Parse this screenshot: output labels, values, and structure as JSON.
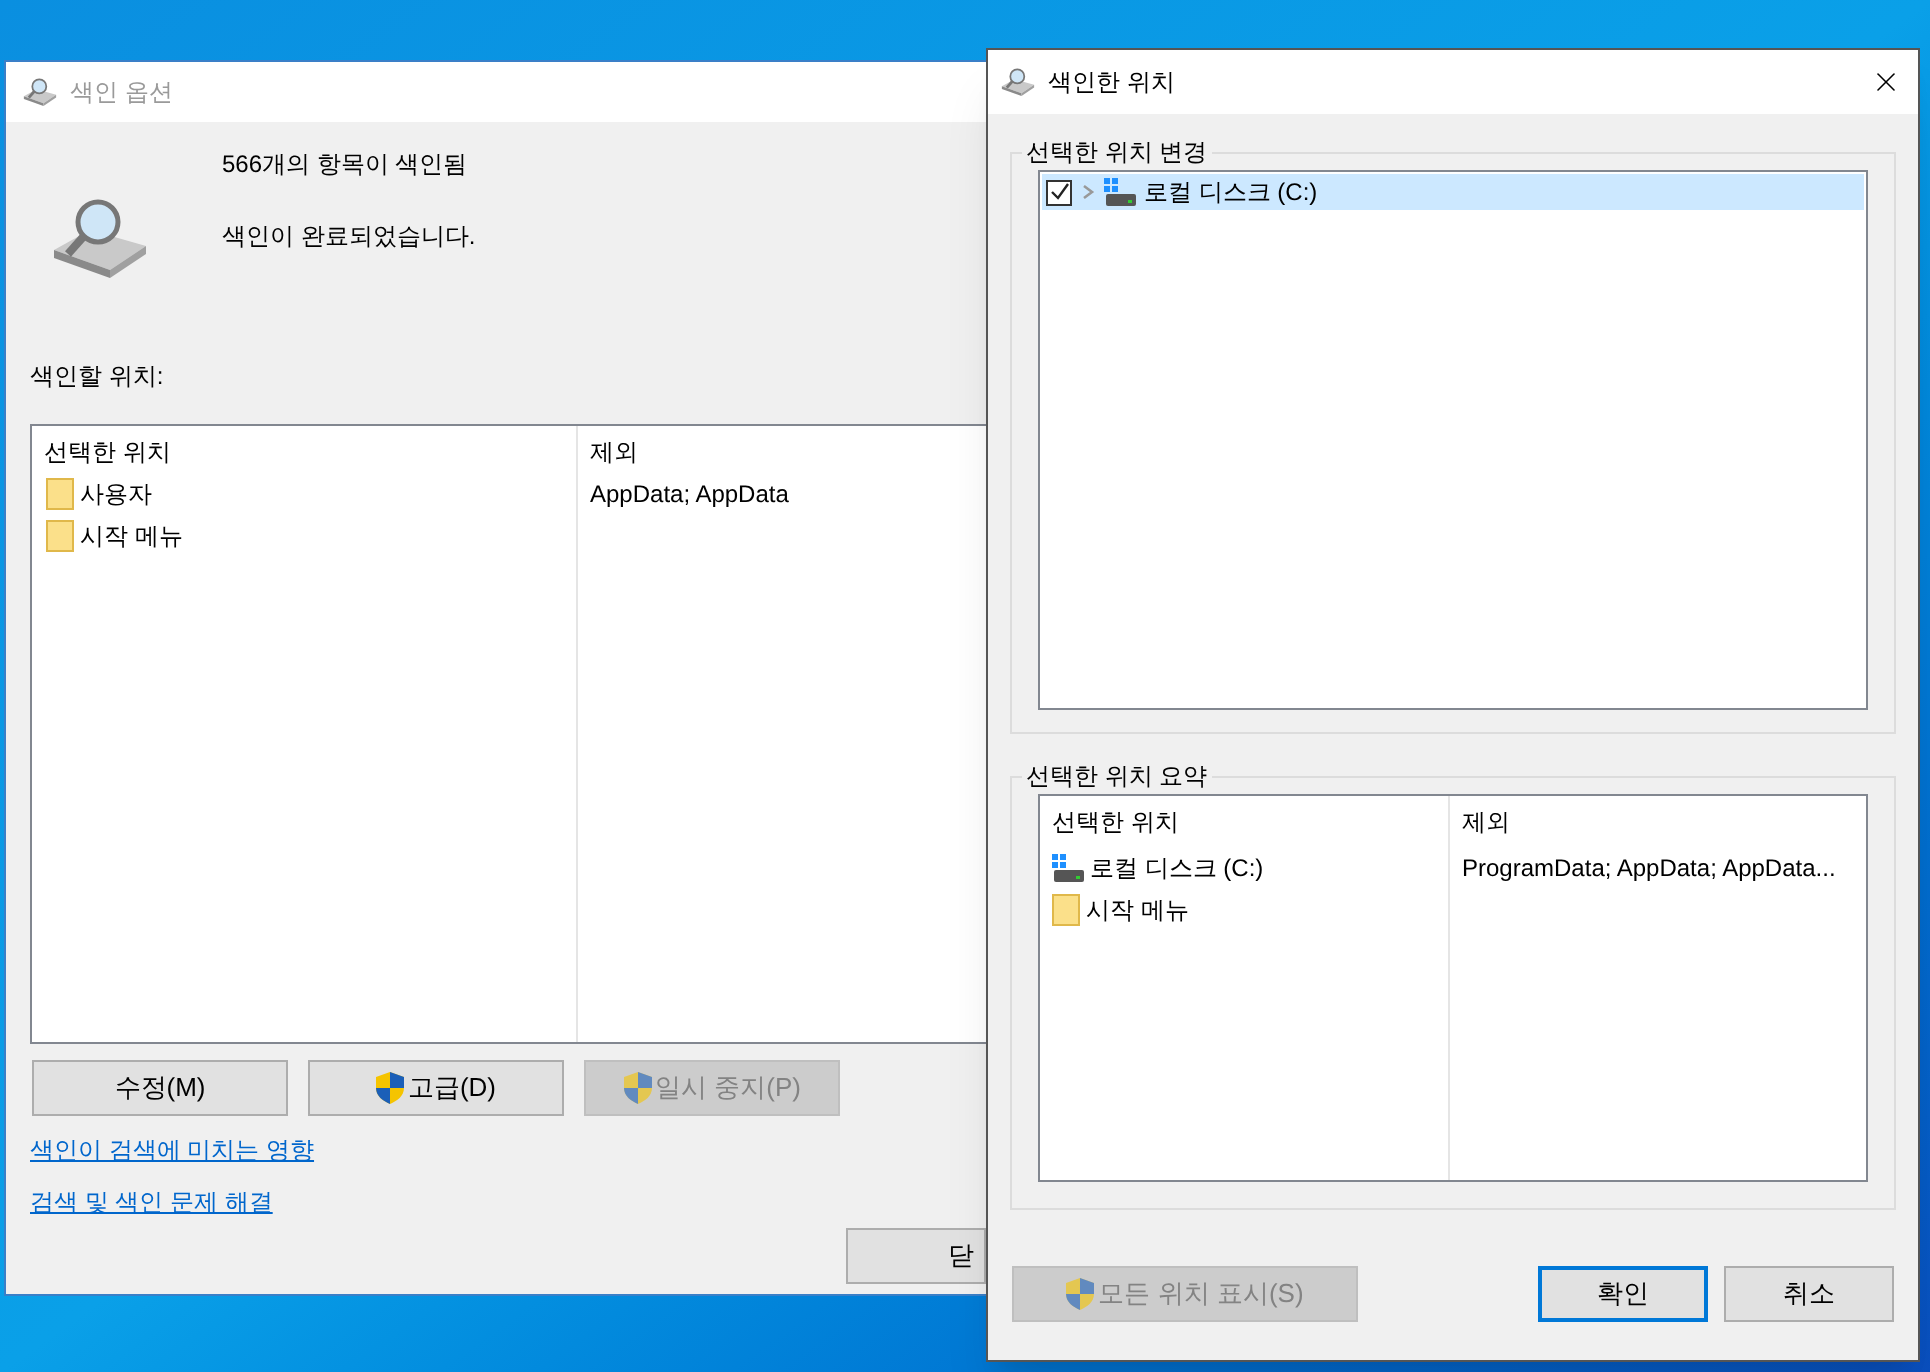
{
  "indexing_options": {
    "title": "색인 옵션",
    "status_lines": [
      "566개의 항목이 색인됨",
      "색인이 완료되었습니다."
    ],
    "locations_label": "색인할 위치:",
    "table": {
      "columns": [
        "선택한 위치",
        "제외"
      ],
      "rows": [
        {
          "kind": "folder",
          "location": "사용자",
          "exclude": "AppData; AppData"
        },
        {
          "kind": "folder",
          "location": "시작 메뉴"
        }
      ]
    },
    "buttons": [
      {
        "label": "수정(M)",
        "shield": false,
        "disabled": false
      },
      {
        "label": "고급(D)",
        "shield": true,
        "disabled": false
      },
      {
        "label": "일시 중지(P)",
        "shield": true,
        "disabled": true
      }
    ],
    "links": [
      "색인이 검색에 미치는 영향",
      "검색 및 색인 문제 해결"
    ],
    "close_button": "닫"
  },
  "indexed_locations": {
    "title": "색인한 위치",
    "change_group": {
      "title": "선택한 위치 변경",
      "items": [
        {
          "kind": "drive",
          "label": "로컬 디스크 (C:)",
          "checked": true,
          "selected": true,
          "expanded": false
        }
      ]
    },
    "summary_group": {
      "title": "선택한 위치 요약",
      "columns": [
        "선택한 위치",
        "제외"
      ],
      "rows": [
        {
          "kind": "drive",
          "location": "로컬 디스크 (C:)",
          "exclude": "ProgramData; AppData; AppData..."
        },
        {
          "kind": "folder",
          "location": "시작 메뉴"
        }
      ]
    },
    "buttons": [
      {
        "label": "모든 위치 표시(S)",
        "shield": true,
        "disabled": true,
        "default": false
      },
      {
        "label": "확인",
        "shield": false,
        "disabled": false,
        "default": true
      },
      {
        "label": "취소",
        "shield": false,
        "disabled": false,
        "default": false
      }
    ]
  }
}
